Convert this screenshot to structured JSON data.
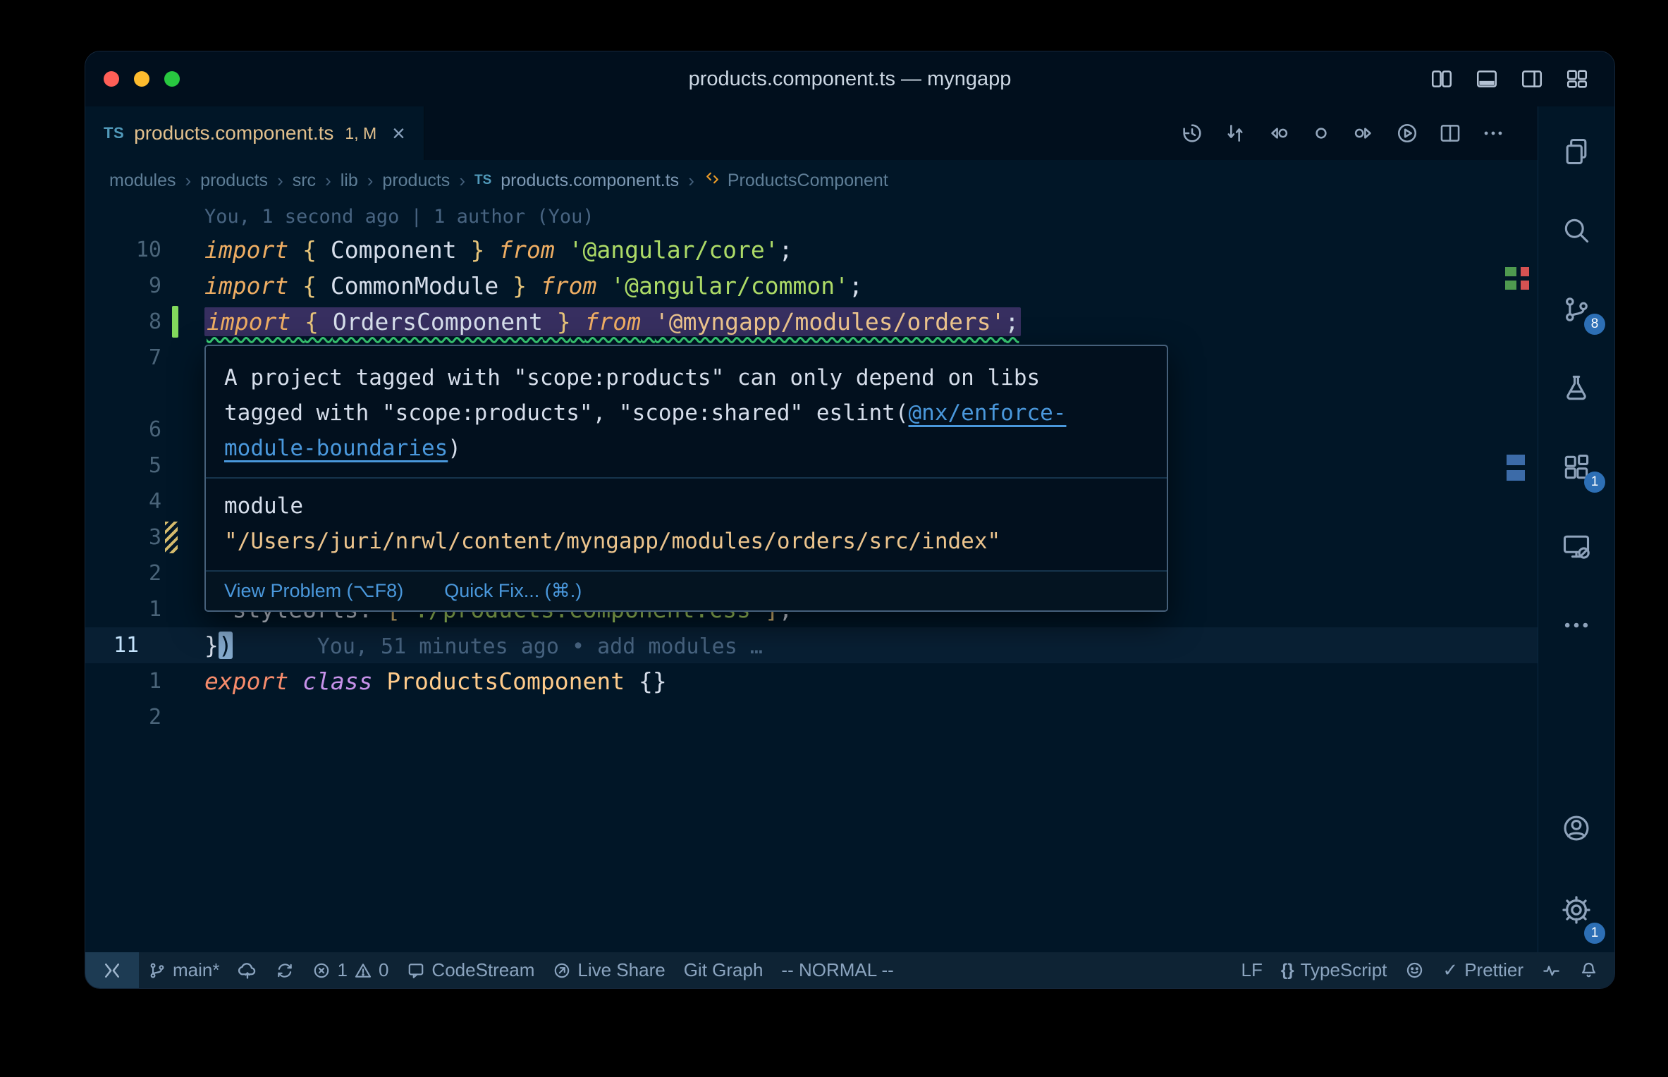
{
  "window": {
    "title": "products.component.ts — myngapp"
  },
  "tab": {
    "ts": "TS",
    "label": "products.component.ts",
    "decor": "1, M",
    "close": "×"
  },
  "breadcrumbs": {
    "sep": "›",
    "items": [
      "modules",
      "products",
      "src",
      "lib",
      "products"
    ],
    "file_ts": "TS",
    "file": "products.component.ts",
    "symbol": "ProductsComponent"
  },
  "editor": {
    "rows": [
      {
        "type": "blame",
        "text": "You, 1 second ago | 1 author (You)"
      },
      {
        "num": "10",
        "tokens": [
          [
            "import",
            "kw"
          ],
          [
            " ",
            "pl"
          ],
          [
            "{ ",
            "br"
          ],
          [
            "Component",
            "id"
          ],
          [
            " }",
            "br"
          ],
          [
            " ",
            "pl"
          ],
          [
            "from",
            "kw"
          ],
          [
            " ",
            "pl"
          ],
          [
            "'@angular/core'",
            "str"
          ],
          [
            ";",
            "pl"
          ]
        ]
      },
      {
        "num": "9",
        "tokens": [
          [
            "import",
            "kw"
          ],
          [
            " ",
            "pl"
          ],
          [
            "{ ",
            "br"
          ],
          [
            "CommonModule",
            "id"
          ],
          [
            " }",
            "br"
          ],
          [
            " ",
            "pl"
          ],
          [
            "from",
            "kw"
          ],
          [
            " ",
            "pl"
          ],
          [
            "'@angular/common'",
            "str"
          ],
          [
            ";",
            "pl"
          ]
        ]
      },
      {
        "num": "8",
        "marker": "added",
        "error": true,
        "tokens": [
          [
            "import",
            "kw"
          ],
          [
            " ",
            "pl"
          ],
          [
            "{ ",
            "br"
          ],
          [
            "OrdersComponent",
            "id"
          ],
          [
            " }",
            "br"
          ],
          [
            " ",
            "pl"
          ],
          [
            "from",
            "kw"
          ],
          [
            " ",
            "pl"
          ],
          [
            "'@myngapp/modules/orders'",
            "strg"
          ],
          [
            ";",
            "pl"
          ]
        ]
      },
      {
        "num": "7"
      },
      {
        "num": ""
      },
      {
        "num": "6"
      },
      {
        "num": "5"
      },
      {
        "num": "4"
      },
      {
        "num": "3",
        "marker": "hatch"
      },
      {
        "num": "2"
      },
      {
        "num": "1",
        "tokens": [
          [
            "  styleUrls",
            "id"
          ],
          [
            ": ",
            "pl"
          ],
          [
            "[",
            "br"
          ],
          [
            "'./products.component.css'",
            "str"
          ],
          [
            "]",
            "br"
          ],
          [
            ",",
            "pl"
          ]
        ]
      },
      {
        "num": "11",
        "current": true,
        "tokens": [
          [
            "}",
            "pl"
          ],
          [
            ")",
            "cur"
          ]
        ],
        "blame": "You, 51 minutes ago • add modules …"
      },
      {
        "num": "1",
        "tokens": [
          [
            "export",
            "kwr"
          ],
          [
            " ",
            "pl"
          ],
          [
            "class",
            "kwm"
          ],
          [
            " ",
            "pl"
          ],
          [
            "ProductsComponent",
            "cls"
          ],
          [
            " ",
            "pl"
          ],
          [
            "{}",
            "pl"
          ]
        ]
      },
      {
        "num": "2"
      }
    ]
  },
  "popup": {
    "msg1": "A project tagged with \"scope:products\" can only depend on libs",
    "msg2": "tagged with \"scope:products\", \"scope:shared\" eslint(",
    "msg2_link": "@nx/enforce-",
    "msg3_link": "module-boundaries",
    "msg3_end": ")",
    "module_label": "module",
    "module_path": "\"/Users/juri/nrwl/content/myngapp/modules/orders/src/index\"",
    "action_view": "View Problem (⌥F8)",
    "action_fix": "Quick Fix... (⌘.)"
  },
  "activity": {
    "scm_badge": "8",
    "ext_badge": "1",
    "gear_badge": "1"
  },
  "status": {
    "branch": "main*",
    "errors": "1",
    "warnings": "0",
    "codestream": "CodeStream",
    "liveshare": "Live Share",
    "gitgraph": "Git Graph",
    "vim": "-- NORMAL --",
    "eol": "LF",
    "lang_icon": "{}",
    "lang": "TypeScript",
    "prettier_check": "✓",
    "prettier": "Prettier"
  }
}
